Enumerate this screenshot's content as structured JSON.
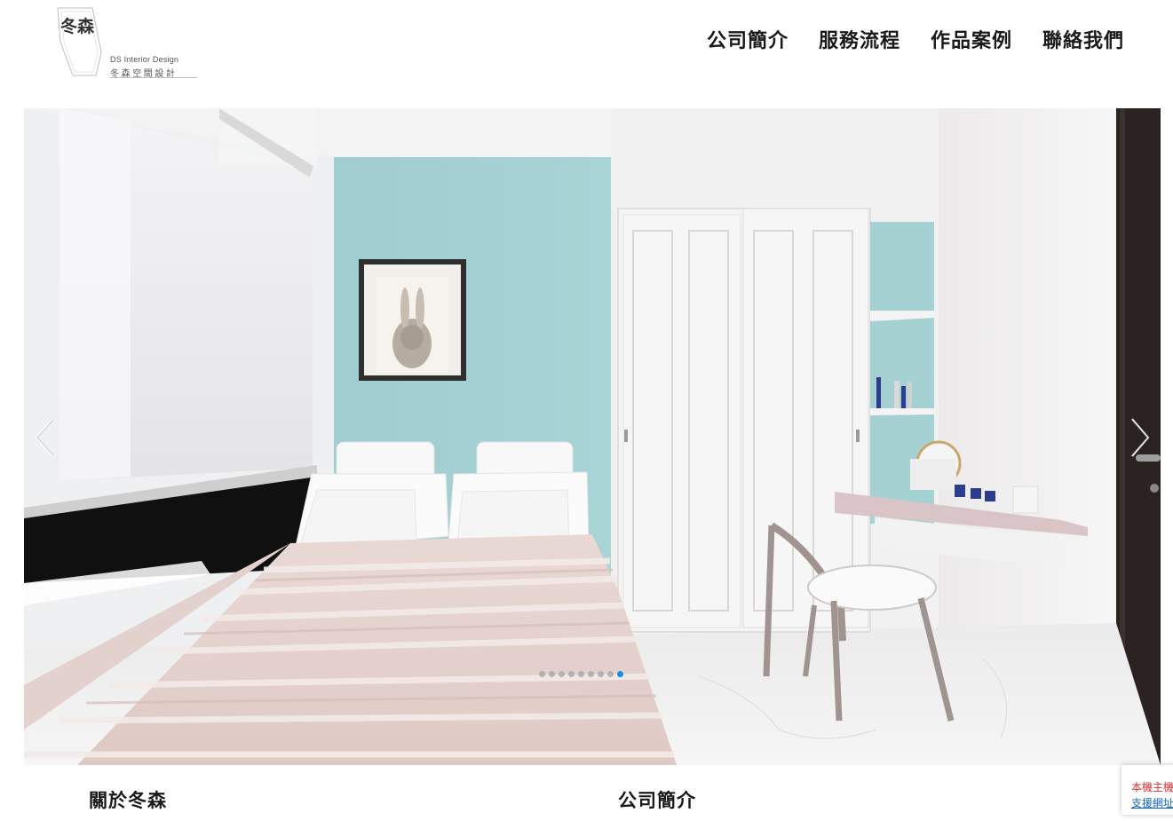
{
  "logo": {
    "badge_text": "冬森",
    "english_name": "DS Interior Design",
    "chinese_name": "冬森空間設計"
  },
  "nav": {
    "items": [
      {
        "label": "公司簡介"
      },
      {
        "label": "服務流程"
      },
      {
        "label": "作品案例"
      },
      {
        "label": "聯絡我們"
      }
    ]
  },
  "slider": {
    "slide_count": 9,
    "active_index": 8,
    "active_dot_color": "#1e88e5"
  },
  "sections": {
    "about_title": "關於冬森",
    "profile_title": "公司簡介"
  },
  "notice": {
    "line1": "本機主機",
    "line2": "支援網址"
  }
}
